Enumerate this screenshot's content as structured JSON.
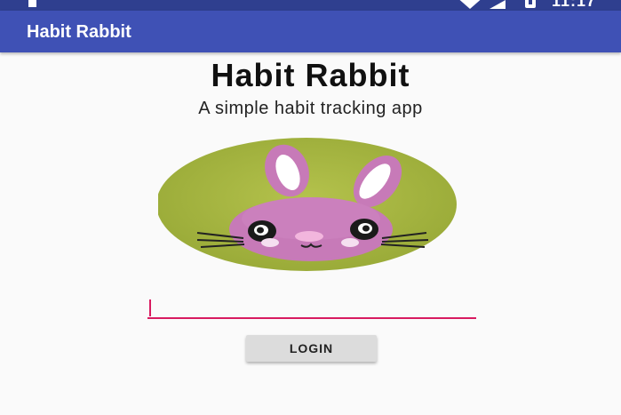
{
  "status_bar": {
    "time": "11:17",
    "icons": [
      "notification-icon",
      "wifi-icon",
      "signal-icon",
      "battery-icon"
    ]
  },
  "app_bar": {
    "title": "Habit Rabbit"
  },
  "main": {
    "title": "Habit Rabbit",
    "subtitle": "A simple habit tracking app",
    "logo_icon": "rabbit-logo-icon"
  },
  "login": {
    "input_value": "",
    "input_placeholder": "",
    "button_label": "LOGIN"
  },
  "colors": {
    "status_bar": "#2f3f8f",
    "app_bar": "#3f51b5",
    "accent": "#d81b60",
    "background": "#fafafa",
    "logo_circle": "#a9b742",
    "rabbit": "#c77ab8"
  }
}
